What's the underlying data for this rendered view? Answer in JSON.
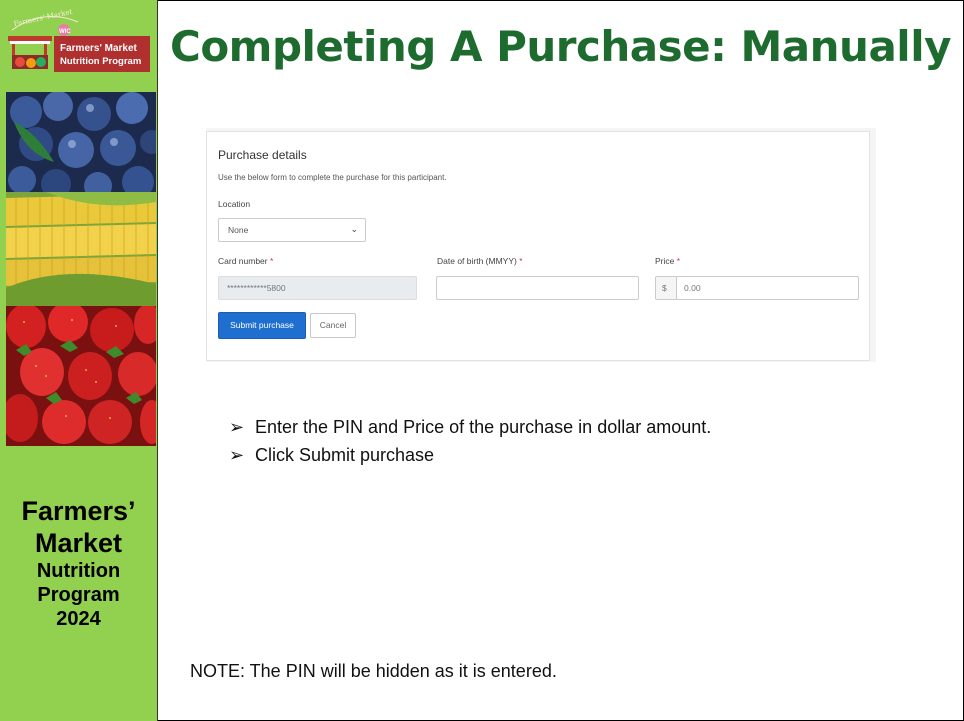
{
  "slide": {
    "title": "Completing A Purchase: Manually"
  },
  "sidebar": {
    "logo": {
      "arc_text": "Farmers' Market",
      "wic": "WIC",
      "line1": "Farmers' Market",
      "line2": "Nutrition Program"
    },
    "images": [
      "blueberries-photo",
      "corn-photo",
      "strawberries-photo"
    ],
    "title_line1": "Farmers’",
    "title_line2": "Market",
    "title_line3": "Nutrition",
    "title_line4": "Program",
    "title_line5": "2024"
  },
  "form": {
    "heading": "Purchase details",
    "description": "Use the below form to complete the purchase for this participant.",
    "location_label": "Location",
    "location_value": "None",
    "card_number_label": "Card number",
    "card_number_value": "************5800",
    "dob_label": "Date of birth (MMYY)",
    "dob_value": "",
    "price_label": "Price",
    "price_prefix": "$",
    "price_placeholder": "0.00",
    "required_marker": "*",
    "submit_label": "Submit purchase",
    "cancel_label": "Cancel"
  },
  "instructions": {
    "bullet_glyph": "➢",
    "items": [
      "Enter the PIN and Price of the purchase in dollar amount.",
      "Click Submit purchase"
    ]
  },
  "note": "NOTE: The PIN will be hidden as it is entered.",
  "colors": {
    "sidebar_green": "#92d050",
    "title_green": "#1e6b2f",
    "primary_button": "#1f6fd1",
    "required_red": "#d9343a"
  }
}
